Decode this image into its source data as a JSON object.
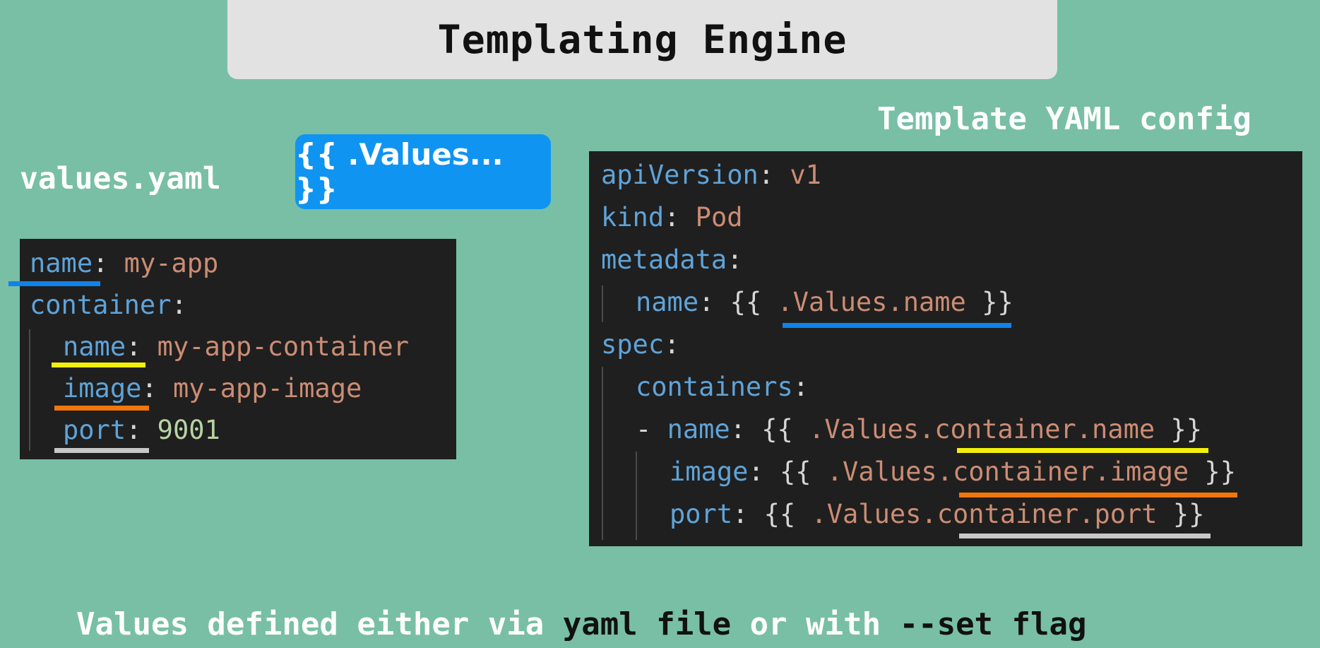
{
  "title": "Templating Engine",
  "labels": {
    "values_file": "values.yaml",
    "template": "Template YAML config"
  },
  "values_pill": "{{ .Values... }}",
  "values_yaml": {
    "line1": {
      "key": "name",
      "sep": ": ",
      "value": "my-app"
    },
    "line2": {
      "key": "container",
      "sep": ":"
    },
    "line3": {
      "key": "name",
      "sep": ": ",
      "value": "my-app-container"
    },
    "line4": {
      "key": "image",
      "sep": ": ",
      "value": "my-app-image"
    },
    "line5": {
      "key": "port",
      "sep": ": ",
      "value": "9001"
    }
  },
  "template_yaml": {
    "line1": {
      "key": "apiVersion",
      "sep": ": ",
      "value": "v1"
    },
    "line2": {
      "key": "kind",
      "sep": ": ",
      "value": "Pod"
    },
    "line3": {
      "key": "metadata",
      "sep": ":"
    },
    "line4": {
      "key": "name",
      "sep": ": ",
      "open": "{{ ",
      "ref": ".Values.name",
      "close": " }}"
    },
    "line5": {
      "key": "spec",
      "sep": ":"
    },
    "line6": {
      "key": "containers",
      "sep": ":"
    },
    "line7": {
      "dash": "- ",
      "key": "name",
      "sep": ": ",
      "open": "{{ ",
      "ref_prefix": ".Values.",
      "ref": "container.name",
      "close": " }}"
    },
    "line8": {
      "key": "image",
      "sep": ": ",
      "open": "{{ ",
      "ref_prefix": ".Values.",
      "ref": "container.image",
      "close": " }}"
    },
    "line9": {
      "key": "port",
      "sep": ": ",
      "open": "{{ ",
      "ref_prefix": ".Values.",
      "ref": "container.port",
      "close": " }}"
    }
  },
  "footer": {
    "part1": "Values defined either via ",
    "part2": "yaml file",
    "part3": " or with ",
    "part4": "--set flag"
  },
  "colors": {
    "background": "#78bfa6",
    "code_panel": "#1f1f1f",
    "key": "#5fa3d8",
    "string": "#cc8c74",
    "number": "#b8d3a3",
    "pill": "#0f94f2",
    "highlight_name": "#1182e8",
    "highlight_container_name": "#f2ef0b",
    "highlight_container_image": "#f1760b",
    "highlight_container_port": "#c8c8c8"
  }
}
